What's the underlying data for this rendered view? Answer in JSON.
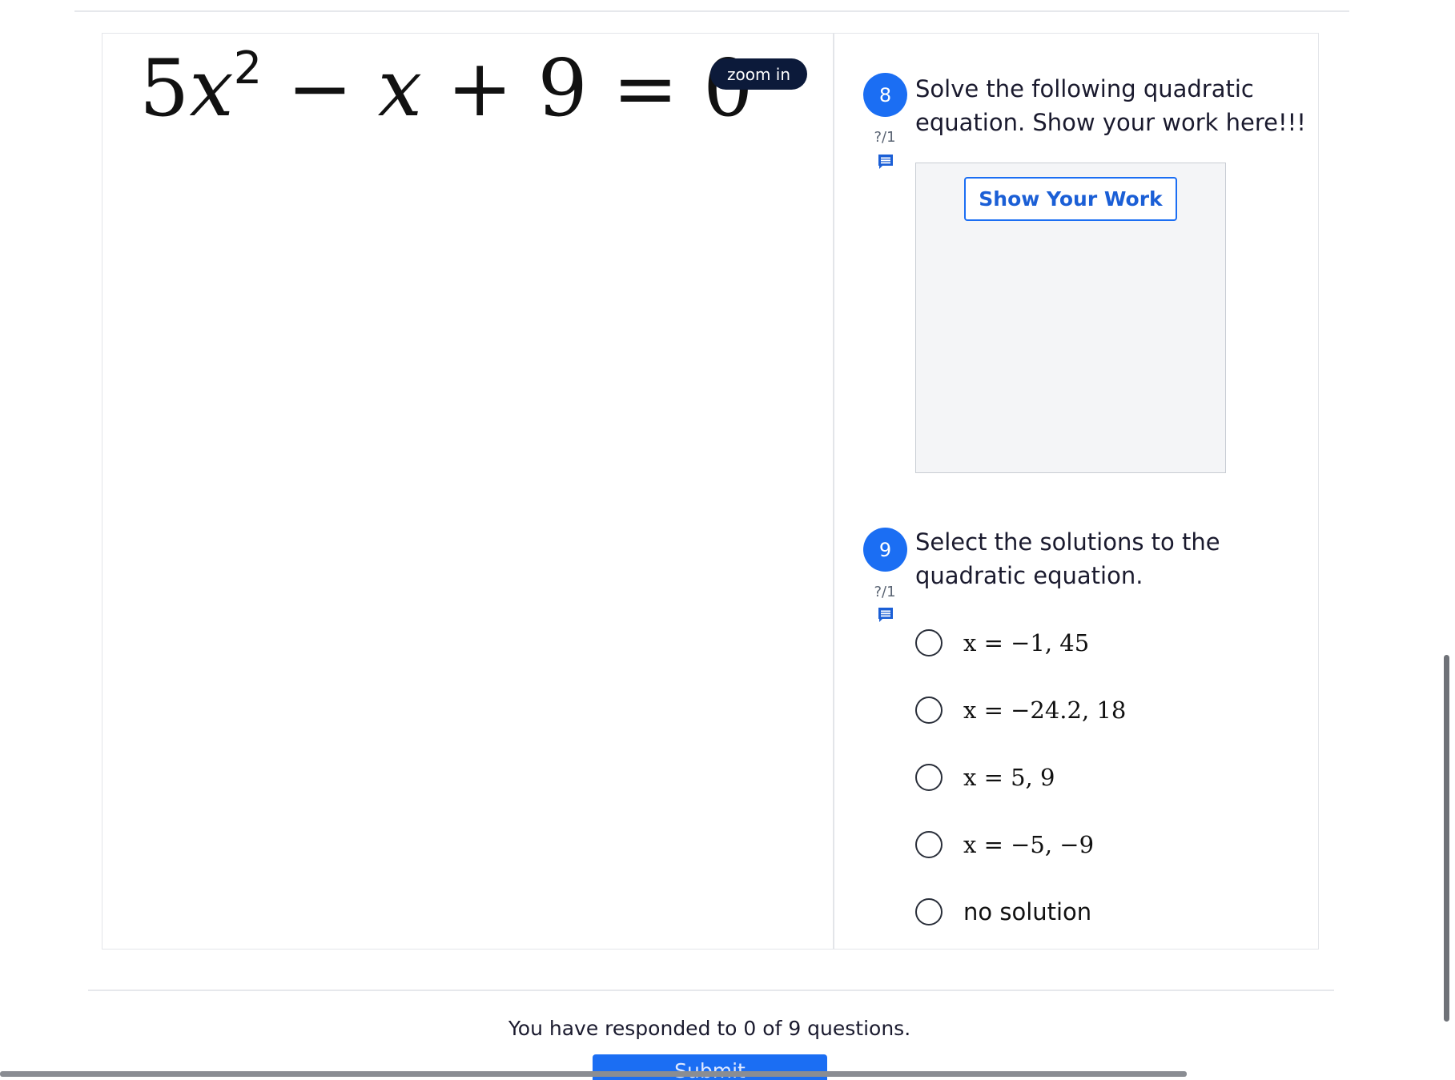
{
  "equation_panel": {
    "coef": "5",
    "var": "x",
    "exponent": "2",
    "rest": " − ",
    "var2": "x",
    "tail": " + 9 = 0",
    "zoom_label": "zoom in"
  },
  "questions": [
    {
      "number": "8",
      "score": "?/1",
      "prompt": "Solve the following quadratic equation. Show your work here!!!",
      "work_button": "Show Your Work"
    },
    {
      "number": "9",
      "score": "?/1",
      "prompt": "Select the solutions to the quadratic equation.",
      "options": [
        {
          "label": "x = −1, 45"
        },
        {
          "label": "x = −24.2, 18"
        },
        {
          "label": "x = 5, 9"
        },
        {
          "label": "x = −5, −9"
        },
        {
          "label": "no solution"
        }
      ]
    }
  ],
  "footer": {
    "status": "You have responded to 0 of 9 questions.",
    "submit_label": "Submit"
  },
  "colors": {
    "accent": "#1b6ef3",
    "zoom_pill": "#0c1a3a",
    "work_area": "#f4f5f7"
  }
}
